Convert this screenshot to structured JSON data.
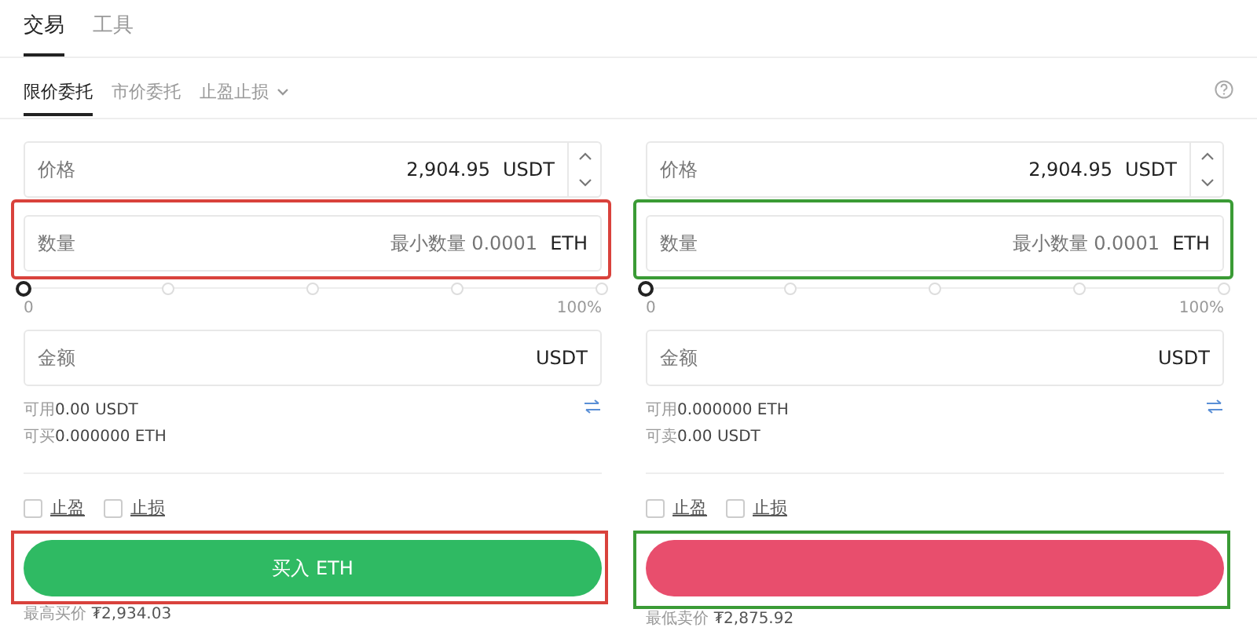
{
  "top_tabs": [
    {
      "label": "交易",
      "selected": true
    },
    {
      "label": "工具",
      "selected": false
    }
  ],
  "order_types": [
    {
      "label": "限价委托",
      "selected": true,
      "dropdown": false
    },
    {
      "label": "市价委托",
      "selected": false,
      "dropdown": false
    },
    {
      "label": "止盈止损",
      "selected": false,
      "dropdown": true
    }
  ],
  "panels": [
    {
      "color": "#d9423c",
      "price": {
        "label": "价格",
        "value": "2,904.95",
        "unit": "USDT"
      },
      "quantity": {
        "label": "数量",
        "placeholder": "最小数量 0.0001",
        "unit": "ETH",
        "highlighted": true
      },
      "slider": {
        "level": 0,
        "min_label": "0",
        "max_label": "100%"
      },
      "amount": {
        "label": "金额",
        "unit": "USDT"
      },
      "balances": [
        {
          "label": "可用",
          "value": "0.00 USDT"
        },
        {
          "label": "可买",
          "value": "0.000000 ETH"
        }
      ],
      "options": [
        {
          "label": "止盈",
          "checked": false
        },
        {
          "label": "止损",
          "checked": false
        }
      ],
      "button": {
        "kind": "buy",
        "label": "买入 ETH",
        "highlighted": true
      },
      "best_price": {
        "label": "最高买价",
        "value": "₮2,934.03"
      }
    },
    {
      "color": "#3a9b35",
      "price": {
        "label": "价格",
        "value": "2,904.95",
        "unit": "USDT"
      },
      "quantity": {
        "label": "数量",
        "placeholder": "最小数量 0.0001",
        "unit": "ETH",
        "highlighted": true
      },
      "slider": {
        "level": 0,
        "min_label": "0",
        "max_label": "100%"
      },
      "amount": {
        "label": "金额",
        "unit": "USDT"
      },
      "balances": [
        {
          "label": "可用",
          "value": "0.000000 ETH"
        },
        {
          "label": "可卖",
          "value": "0.00 USDT"
        }
      ],
      "options": [
        {
          "label": "止盈",
          "checked": false
        },
        {
          "label": "止损",
          "checked": false
        }
      ],
      "button": {
        "kind": "sell",
        "highlighted": true
      },
      "best_price": {
        "label": "最低卖价",
        "value": "₮2,875.92"
      }
    }
  ]
}
